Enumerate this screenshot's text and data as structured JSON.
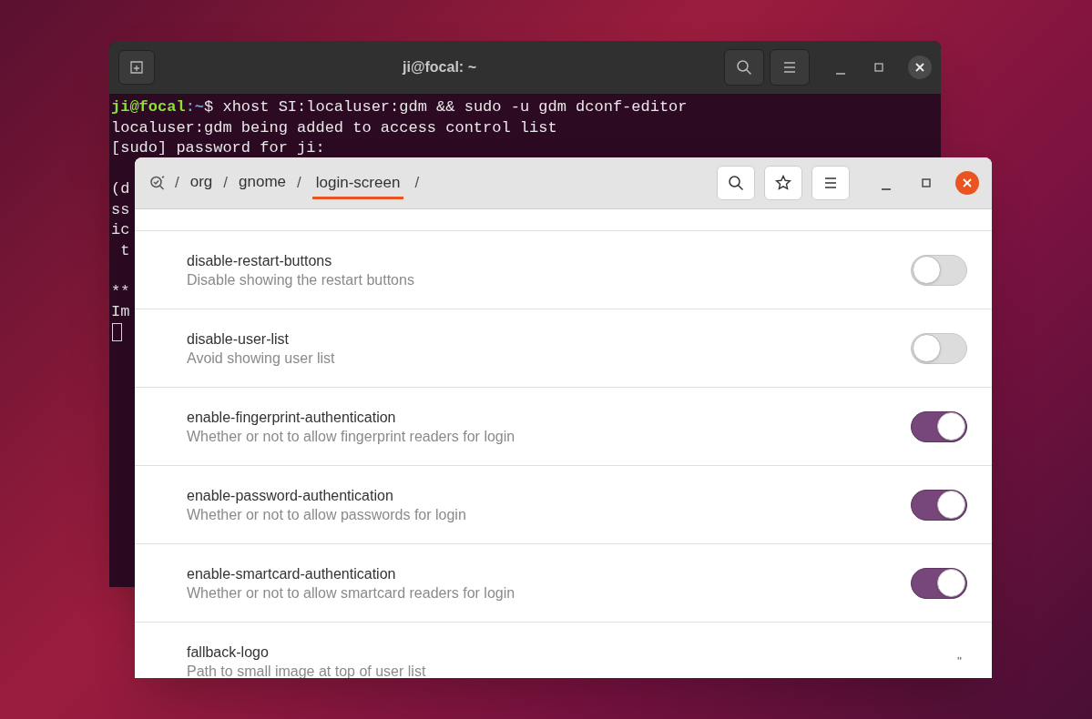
{
  "terminal": {
    "title": "ji@focal: ~",
    "lines": [
      {
        "prompt_user": "ji@focal",
        "prompt_path": ":~",
        "prompt_sign": "$",
        "command": " xhost SI:localuser:gdm && sudo -u gdm dconf-editor"
      },
      {
        "text": "localuser:gdm being added to access control list"
      },
      {
        "text": "[sudo] password for ji:"
      }
    ],
    "blocks": [
      [
        "(d",
        "ss",
        "ic",
        " t"
      ],
      [
        "**",
        "Im"
      ]
    ]
  },
  "dconf": {
    "path": [
      {
        "label": "org",
        "selected": false
      },
      {
        "label": "gnome",
        "selected": false
      },
      {
        "label": "login-screen",
        "selected": true
      }
    ],
    "separator": "/",
    "rows": [
      {
        "kind": "toggle",
        "key": "disable-restart-buttons",
        "description": "Disable showing the restart buttons",
        "on": false
      },
      {
        "kind": "toggle",
        "key": "disable-user-list",
        "description": "Avoid showing user list",
        "on": false
      },
      {
        "kind": "toggle",
        "key": "enable-fingerprint-authentication",
        "description": "Whether or not to allow fingerprint readers for login",
        "on": true
      },
      {
        "kind": "toggle",
        "key": "enable-password-authentication",
        "description": "Whether or not to allow passwords for login",
        "on": true
      },
      {
        "kind": "toggle",
        "key": "enable-smartcard-authentication",
        "description": "Whether or not to allow smartcard readers for login",
        "on": true
      },
      {
        "kind": "text",
        "key": "fallback-logo",
        "description": "Path to small image at top of user list",
        "value": "''"
      }
    ]
  }
}
